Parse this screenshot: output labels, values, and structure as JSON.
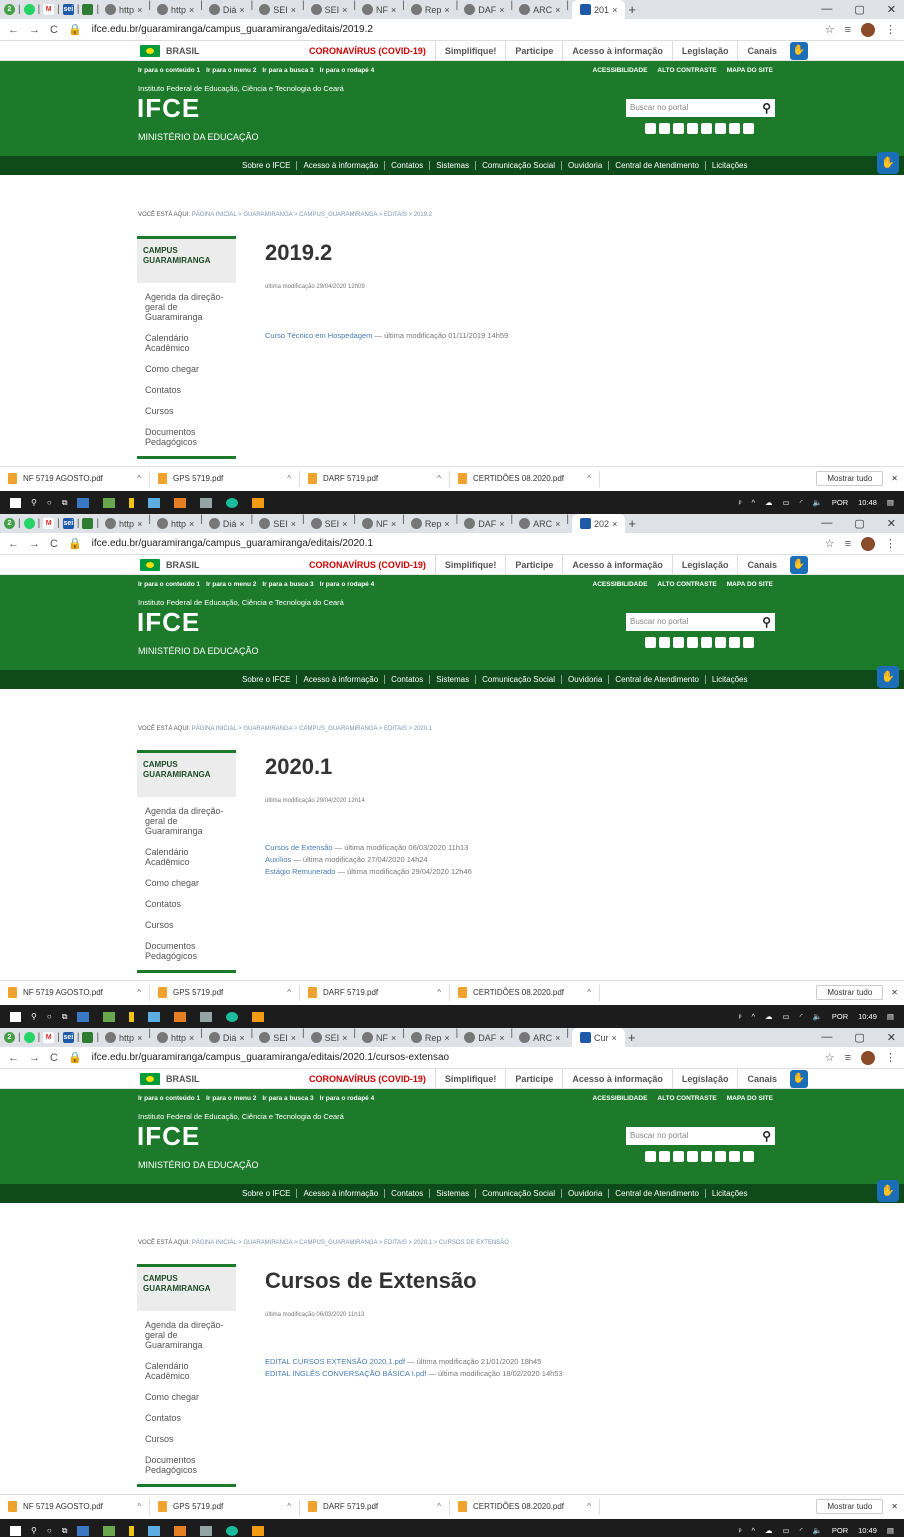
{
  "shots": [
    {
      "active_tab": "201",
      "url": "ifce.edu.br/guaramiranga/campus_guaramiranga/editais/2019.2",
      "breadcrumb_path": "PÁGINA INICIAL > GUARAMIRANGA > CAMPUS_GUARAMIRANGA > EDITAIS > 2019.2",
      "title": "2019.2",
      "modified": "última modificação 29/04/2020 12h09",
      "items": [
        {
          "link": "Curso Técnico em Hospedagem",
          "rest": " — última modificação 01/11/2019 14h59"
        }
      ],
      "time": "10:48"
    },
    {
      "active_tab": "202",
      "url": "ifce.edu.br/guaramiranga/campus_guaramiranga/editais/2020.1",
      "breadcrumb_path": "PÁGINA INICIAL > GUARAMIRANGA > CAMPUS_GUARAMIRANGA > EDITAIS > 2020.1",
      "title": "2020.1",
      "modified": "última modificação 29/04/2020 12h14",
      "items": [
        {
          "link": "Cursos de Extensão",
          "rest": " — última modificação 06/03/2020 11h13"
        },
        {
          "link": "Auxílios",
          "rest": " — última modificação 27/04/2020 14h24"
        },
        {
          "link": "Estágio Remunerado",
          "rest": " — última modificação 29/04/2020 12h46"
        }
      ],
      "time": "10:49"
    },
    {
      "active_tab": "Cur",
      "url": "ifce.edu.br/guaramiranga/campus_guaramiranga/editais/2020.1/cursos-extensao",
      "breadcrumb_path": "PÁGINA INICIAL > GUARAMIRANGA > CAMPUS_GUARAMIRANGA > EDITAIS > 2020.1 > CURSOS DE EXTENSÃO",
      "title": "Cursos de Extensão",
      "modified": "última modificação 06/03/2020 11h13",
      "items": [
        {
          "link": "EDITAL CURSOS EXTENSÃO 2020.1.pdf",
          "rest": " — última modificação 21/01/2020 18h45"
        },
        {
          "link": "EDITAL INGLÊS CONVERSAÇÃO BÁSICA I.pdf",
          "rest": " — última modificação 18/02/2020 14h53"
        }
      ],
      "time": "10:49"
    }
  ],
  "tabs": [
    "http",
    "http",
    "Diá",
    "SEI",
    "SEI",
    "NF",
    "Rep",
    "DAF",
    "ARC"
  ],
  "gov": {
    "brasil": "BRASIL",
    "links": [
      "CORONAVÍRUS (COVID-19)",
      "Simplifique!",
      "Participe",
      "Acesso à informação",
      "Legislação",
      "Canais"
    ]
  },
  "header": {
    "skip_links": [
      "Ir para o conteúdo 1",
      "Ir para o menu 2",
      "Ir para a busca 3",
      "Ir para o rodapé 4"
    ],
    "access_links": [
      "ACESSIBILIDADE",
      "ALTO CONTRASTE",
      "MAPA DO SITE"
    ],
    "institute": "Instituto Federal de Educação, Ciência e Tecnologia do Ceará",
    "logo": "IFCE",
    "ministry": "MINISTÉRIO DA EDUCAÇÃO",
    "search_placeholder": "Buscar no portal"
  },
  "nav": [
    "Sobre o IFCE",
    "Acesso à informação",
    "Contatos",
    "Sistemas",
    "Comunicação Social",
    "Ouvidoria",
    "Central de Atendimento",
    "Licitações"
  ],
  "breadcrumb_label": "VOCÊ ESTÁ AQUI:",
  "sidebar": {
    "heading": "CAMPUS GUARAMIRANGA",
    "items": [
      "Agenda da direção-geral de Guaramiranga",
      "Calendário Acadêmico",
      "Como chegar",
      "Contatos",
      "Cursos",
      "Documentos Pedagógicos"
    ]
  },
  "downloads": [
    "NF 5719 AGOSTO.pdf",
    "GPS 5719.pdf",
    "DARF 5719.pdf",
    "CERTIDÕES 08.2020.pdf"
  ],
  "show_all": "Mostrar tudo",
  "tray": {
    "lang": "POR"
  },
  "colors": {
    "green": "#1d7a2b",
    "dark_green": "#0f4a1a",
    "link": "#4a7bb5",
    "covid": "#cc0000"
  }
}
